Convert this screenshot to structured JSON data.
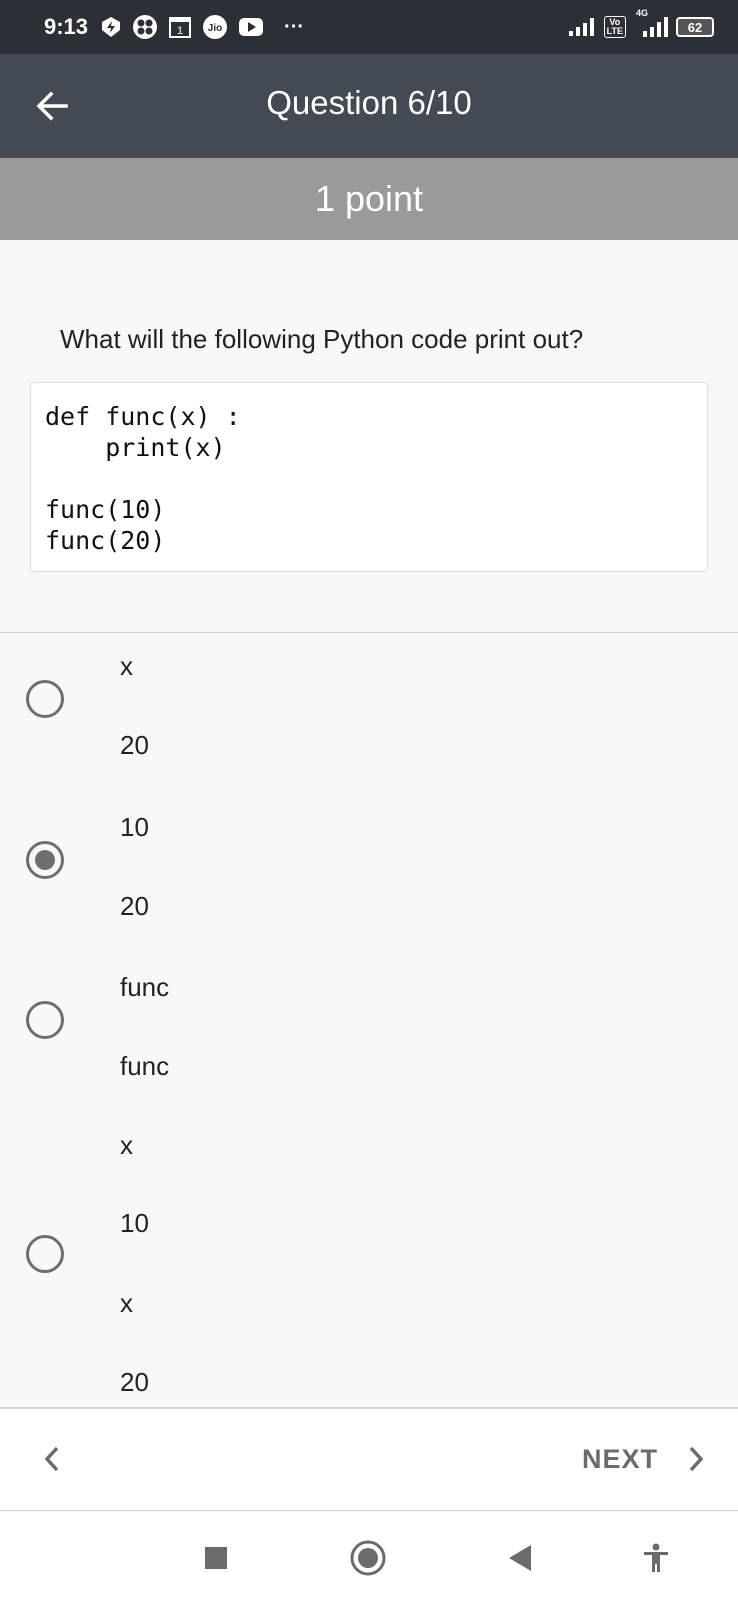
{
  "status_bar": {
    "time": "9:13",
    "jio_label": "Jio",
    "calendar_day": "1",
    "more": "···",
    "volte_top": "Vo",
    "volte_bottom": "LTE",
    "network": "4G",
    "battery": "62",
    "icons": [
      "bolt-icon",
      "flower-icon",
      "calendar-icon",
      "jio-icon",
      "youtube-icon",
      "signal-icon",
      "signal-4g-icon",
      "battery-icon"
    ]
  },
  "app_bar": {
    "title": "Question 6/10",
    "back_icon": "arrow-left-icon"
  },
  "points": "1 point",
  "question": {
    "text": "What will the following Python code print out?",
    "code": "def func(x) :\n    print(x)\n\nfunc(10)\nfunc(20)"
  },
  "options": [
    {
      "lines": [
        "x",
        "20"
      ],
      "selected": false
    },
    {
      "lines": [
        "10",
        "20"
      ],
      "selected": true
    },
    {
      "lines": [
        "func",
        "func"
      ],
      "selected": false
    },
    {
      "lines": [
        "x",
        "10",
        "x",
        "20"
      ],
      "selected": false
    }
  ],
  "navigation": {
    "prev_icon": "chevron-left-icon",
    "next_label": "NEXT",
    "next_icon": "chevron-right-icon"
  },
  "system_nav": [
    "square-icon",
    "circle-home-icon",
    "triangle-back-icon",
    "accessibility-icon"
  ],
  "colors": {
    "status_bar": "#2b2f36",
    "app_bar": "#434a53",
    "points_bar": "#9a9a9a",
    "background": "#f8f8f7",
    "radio": "#6e6e6e"
  }
}
